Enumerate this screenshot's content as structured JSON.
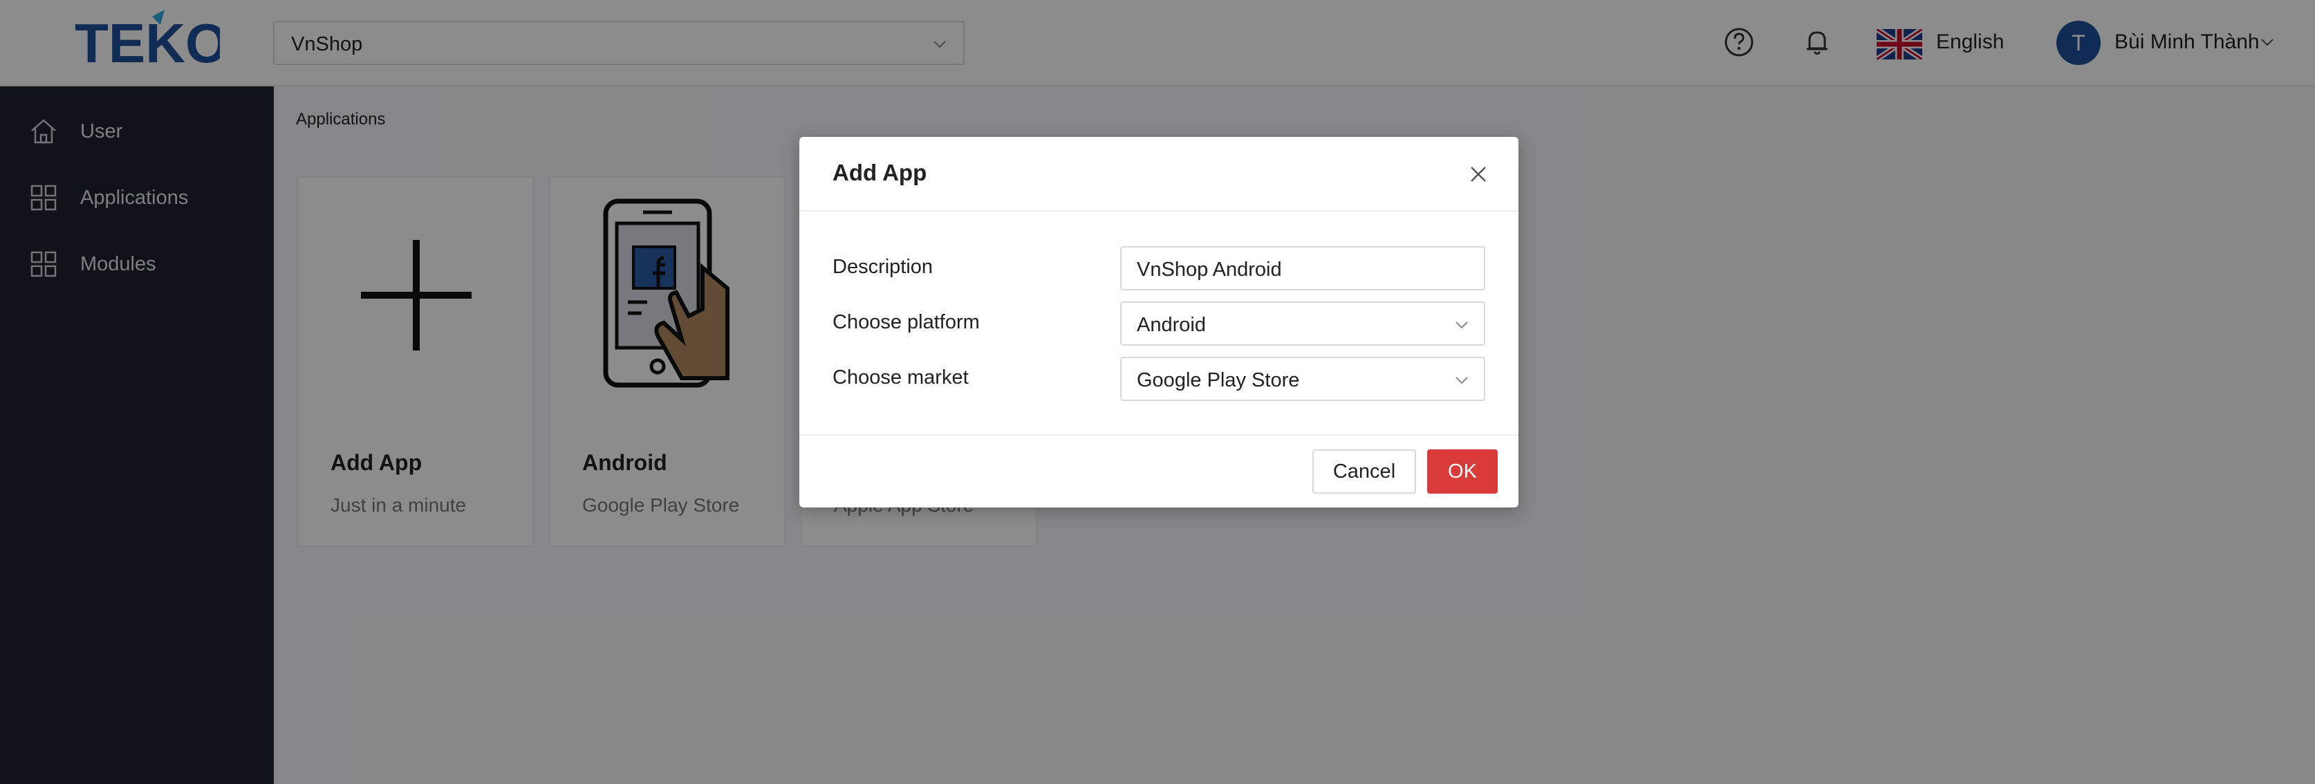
{
  "header": {
    "logo_text": "TEKO",
    "shop_select": {
      "value": "VnShop",
      "icon": "chevron-down-icon"
    },
    "help_icon": "question-circle-icon",
    "notification_icon": "bell-icon",
    "language": {
      "flag": "uk-flag-icon",
      "label": "English"
    },
    "user": {
      "avatar_initial": "T",
      "name": "Bùi Minh Thành",
      "icon": "chevron-down-icon"
    }
  },
  "sidebar": {
    "items": [
      {
        "label": "User",
        "icon": "home-icon"
      },
      {
        "label": "Applications",
        "icon": "grid-icon"
      },
      {
        "label": "Modules",
        "icon": "grid-icon"
      }
    ]
  },
  "main": {
    "breadcrumb": "Applications",
    "cards": [
      {
        "title": "Add App",
        "subtitle": "Just in a minute",
        "icon": "plus-icon"
      },
      {
        "title": "Android",
        "subtitle": "Google Play Store",
        "icon": "phone-facebook-icon"
      },
      {
        "title": "",
        "subtitle": "Apple App Store",
        "icon": ""
      }
    ]
  },
  "modal": {
    "title": "Add App",
    "close_icon": "close-icon",
    "fields": {
      "description": {
        "label": "Description",
        "value": "VnShop Android"
      },
      "platform": {
        "label": "Choose platform",
        "value": "Android"
      },
      "market": {
        "label": "Choose market",
        "value": "Google Play Store"
      }
    },
    "cancel_label": "Cancel",
    "ok_label": "OK"
  },
  "colors": {
    "sidebar_bg": "#1c2531",
    "accent_red": "#d93a3a",
    "avatar_blue": "#1e4f9a",
    "logo_blue": "#1e4f9a",
    "logo_accent": "#2fa9e0"
  }
}
